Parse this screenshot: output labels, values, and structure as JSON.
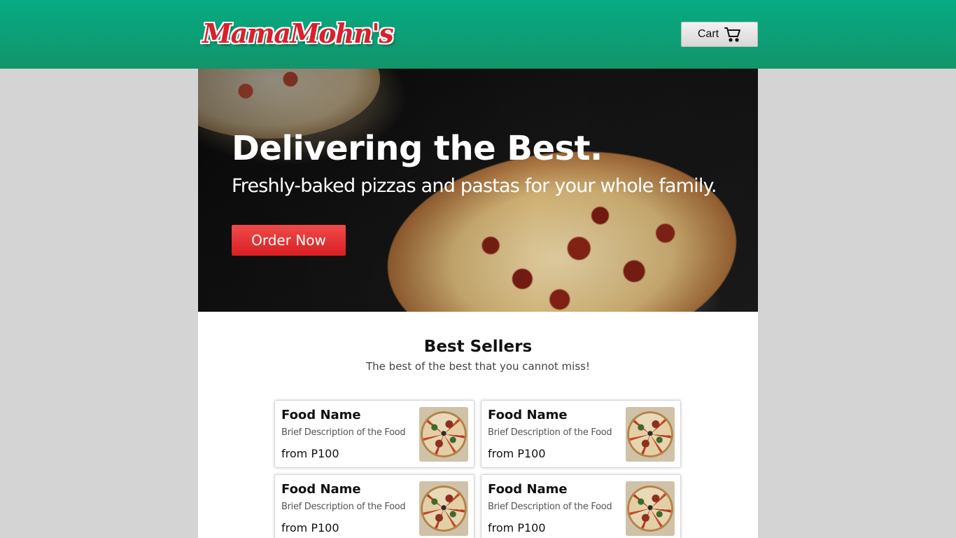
{
  "header": {
    "logo_text": "MamaMohn's",
    "cart_label": "Cart"
  },
  "hero": {
    "title": "Delivering the Best.",
    "subtitle": "Freshly-baked pizzas and pastas for your whole family.",
    "cta_label": "Order Now"
  },
  "best_sellers": {
    "title": "Best Sellers",
    "subtitle": "The best of the best that you cannot miss!",
    "items": [
      {
        "name": "Food Name",
        "description": "Brief Description of the Food",
        "price": "from P100"
      },
      {
        "name": "Food Name",
        "description": "Brief Description of the Food",
        "price": "from P100"
      },
      {
        "name": "Food Name",
        "description": "Brief Description of the Food",
        "price": "from P100"
      },
      {
        "name": "Food Name",
        "description": "Brief Description of the Food",
        "price": "from P100"
      }
    ]
  },
  "colors": {
    "header_green": "#06ab84",
    "logo_red": "#d9202c",
    "cta_red": "#d81f22",
    "page_bg": "#d4d4d4"
  },
  "icons": [
    "cart-icon"
  ]
}
